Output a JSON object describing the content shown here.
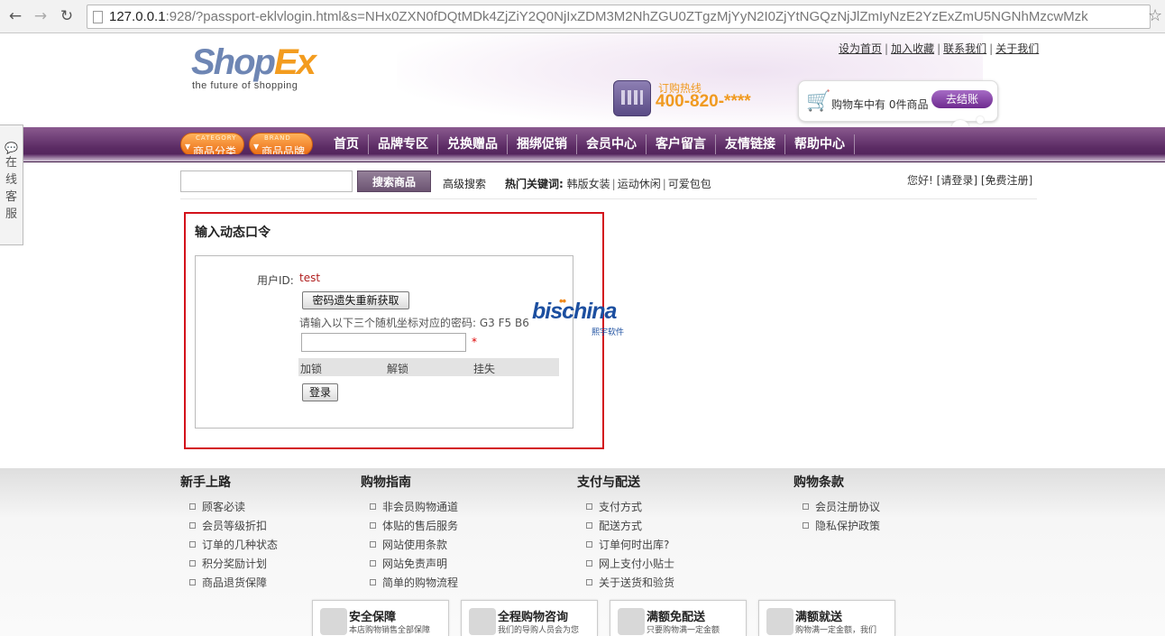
{
  "browser": {
    "url_host": "127.0.0.1",
    "url_rest": ":928/?passport-eklvlogin.html&s=NHx0ZXN0fDQtMDk4ZjZiY2Q0NjIxZDM3M2NhZGU0ZTgzMjYyN2I0ZjYtNGQzNjJlZmIyNzE2YzExZmU5NGNhMzcwMzk"
  },
  "header": {
    "logo_a": "Shop",
    "logo_b": "Ex",
    "slogan": "the future of shopping",
    "top_links": [
      "设为首页",
      "加入收藏",
      "联系我们",
      "关于我们"
    ],
    "hotline_label": "订购热线",
    "hotline_number": "400-820-****",
    "cart_text": "购物车中有 0件商品",
    "checkout_label": "去结账"
  },
  "nav": {
    "category_small": "CATEGORY",
    "category_label": "商品分类",
    "brand_small": "BRAND",
    "brand_label": "商品品牌",
    "items": [
      "首页",
      "品牌专区",
      "兑换赠品",
      "捆绑促销",
      "会员中心",
      "客户留言",
      "友情链接",
      "帮助中心"
    ]
  },
  "side_tab": {
    "chars": [
      "在",
      "线",
      "客",
      "服"
    ]
  },
  "search": {
    "button": "搜索商品",
    "advanced": "高级搜索",
    "hot_label": "热门关键词:",
    "hot_keywords": [
      "韩版女装",
      "运动休闲",
      "可爱包包"
    ],
    "greeting": "您好!",
    "login_link": "[请登录]",
    "register_link": "[免费注册]"
  },
  "login": {
    "title": "输入动态口令",
    "uid_label": "用户ID:",
    "uid_value": "test",
    "regain_button": "密码遗失重新获取",
    "coord_prompt": "请输入以下三个随机坐标对应的密码: G3 F5 B6",
    "required_mark": "*",
    "actions": [
      "加锁",
      "解锁",
      "挂失"
    ],
    "login_button": "登录"
  },
  "watermark": {
    "brand": "bischina",
    "sub": "熙宇软件"
  },
  "footer": {
    "columns": [
      {
        "title": "新手上路",
        "links": [
          "顾客必读",
          "会员等级折扣",
          "订单的几种状态",
          "积分奖励计划",
          "商品退货保障"
        ]
      },
      {
        "title": "购物指南",
        "links": [
          "非会员购物通道",
          "体贴的售后服务",
          "网站使用条款",
          "网站免责声明",
          "简单的购物流程"
        ]
      },
      {
        "title": "支付与配送",
        "links": [
          "支付方式",
          "配送方式",
          "订单何时出库?",
          "网上支付小贴士",
          "关于送货和验货"
        ]
      },
      {
        "title": "购物条款",
        "links": [
          "会员注册协议",
          "隐私保护政策"
        ]
      }
    ],
    "promos": [
      {
        "title": "安全保障",
        "sub": "本店购物销售全部保障"
      },
      {
        "title": "全程购物咨询",
        "sub": "我们的导购人员会为您"
      },
      {
        "title": "满额免配送",
        "sub": "只要购物满一定金额"
      },
      {
        "title": "满额就送",
        "sub": "购物满一定金额，我们"
      }
    ]
  }
}
